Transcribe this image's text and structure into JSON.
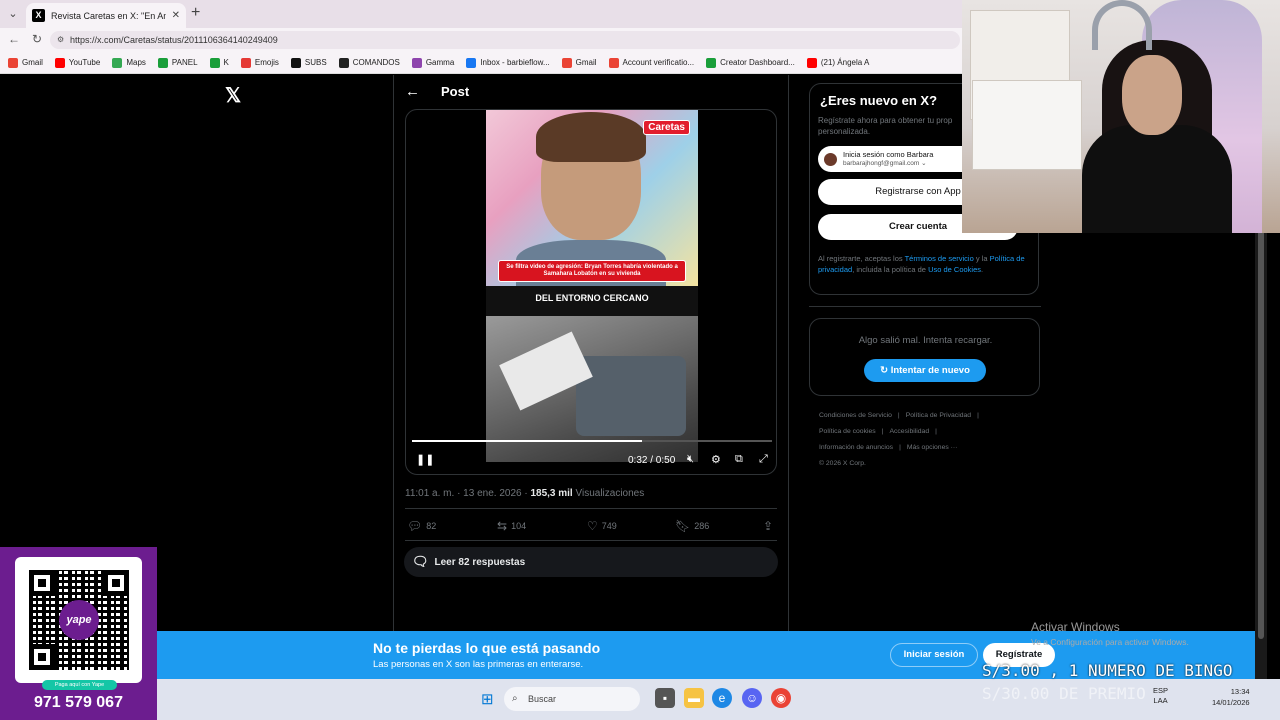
{
  "browser": {
    "tab_title": "Revista Caretas en X: \"En Amor y F",
    "url": "https://x.com/Caretas/status/2011106364140249409",
    "bookmarks": [
      "Gmail",
      "YouTube",
      "Maps",
      "PANEL",
      "K",
      "Emojis",
      "SUBS",
      "COMANDOS",
      "Gamma",
      "Inbox - barbieflow...",
      "Gmail",
      "Account verificatio...",
      "Creator Dashboard...",
      "(21) Ángela A"
    ],
    "bookmark_colors": [
      "#ea4335",
      "#ff0000",
      "#34a853",
      "#1a9e3a",
      "#1a9e3a",
      "#e53935",
      "#111111",
      "#222222",
      "#8e44ad",
      "#1877f2",
      "#ea4335",
      "#ea4335",
      "#1a9e3a",
      "#ff0000"
    ]
  },
  "post": {
    "header_title": "Post",
    "video": {
      "brand": "Caretas",
      "headline": "Se filtra video de agresión: Bryan Torres habría violentado a Samahara Lobatón en su vivienda",
      "caption": "DEL ENTORNO CERCANO",
      "time": "0:32 / 0:50",
      "progress": 0.64
    },
    "timestamp": "11:01 a. m. · 13 ene. 2026 · ",
    "views_count": "185,3 mil",
    "views_label": " Visualizaciones",
    "replies": "82",
    "reposts": "104",
    "likes": "749",
    "bookmarks": "286",
    "read_replies": "Leer 82 respuestas"
  },
  "sidebar": {
    "signup_title": "¿Eres nuevo en X?",
    "signup_sub": "Regístrate ahora para obtener tu prop personalizada.",
    "google_line1": "Inicia sesión como Barbara",
    "google_line2": "barbarajhongf@gmail.com ⌄",
    "apple_label": "Registrarse con App",
    "create_label": "Crear cuenta",
    "legal_1": "Al registrarte, aceptas los ",
    "legal_terms": "Términos de servicio",
    "legal_2": " y la ",
    "legal_privacy": "Política de privacidad",
    "legal_3": ", incluida la política de ",
    "legal_cookies": "Uso de Cookies",
    "legal_4": ".",
    "error_msg": "Algo salió mal. Intenta recargar.",
    "retry_label": "Intentar de nuevo",
    "footer": [
      "Condiciones de Servicio",
      "|",
      "Política de Privacidad",
      "|",
      "Política de cookies",
      "|",
      "Accesibilidad",
      "|",
      "Información de anuncios",
      "|",
      "Más opciones ···",
      "© 2026 X Corp."
    ]
  },
  "banner": {
    "title": "No te pierdas lo que está pasando",
    "subtitle": "Las personas en X son las primeras en enterarse.",
    "login": "Iniciar sesión",
    "register": "Regístrate"
  },
  "overlay": {
    "activate_title": "Activar Windows",
    "activate_sub": "Ve a Configuración para activar Windows.",
    "bingo_1": "S/3.00 , 1 NUMERO DE BINGO",
    "bingo_2": "S/30.00 DE PREMIO",
    "yape_pill": "Paga aquí con Yape",
    "phone": "971 579 067",
    "yape_logo": "yape"
  },
  "taskbar": {
    "search_placeholder": "Buscar",
    "lang_1": "ESP",
    "lang_2": "LAA",
    "time": "13:34",
    "date": "14/01/2026"
  },
  "accent": "#1d9bf0"
}
